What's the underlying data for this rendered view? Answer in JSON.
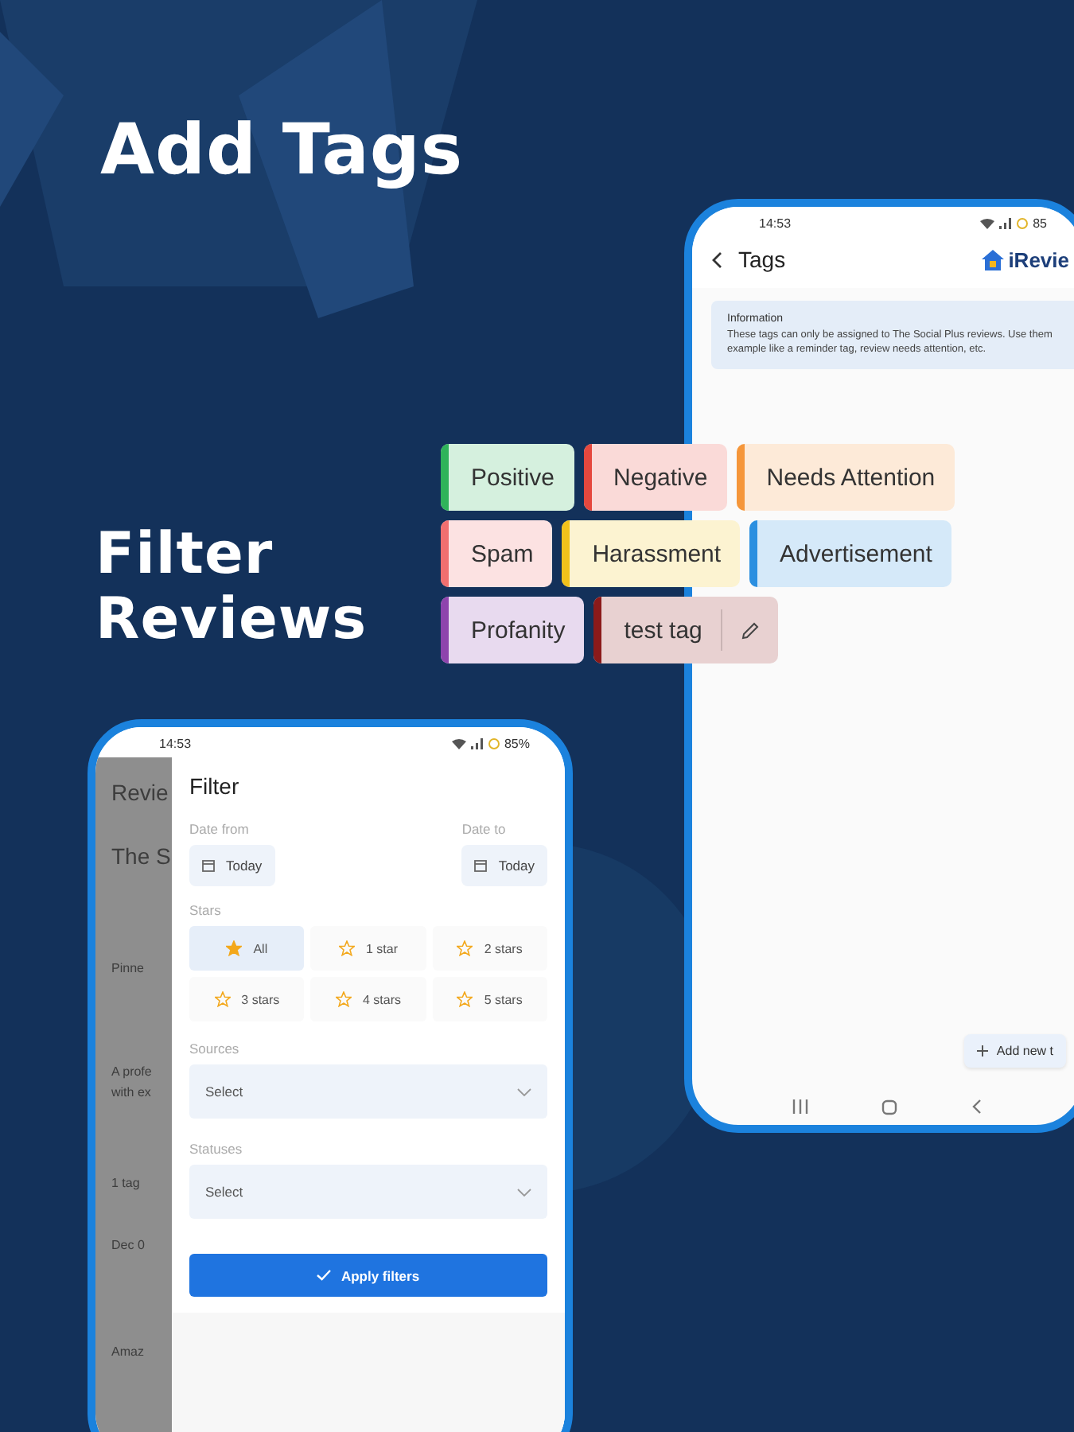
{
  "headlines": [
    {
      "text": "Add Tags"
    },
    {
      "text": "Filter Reviews"
    }
  ],
  "tags_screen": {
    "status": {
      "time": "14:53",
      "battery": "85"
    },
    "title": "Tags",
    "logo": "iRevie",
    "info": {
      "title": "Information",
      "body": "These tags can only be assigned to The Social Plus reviews. Use them example like a reminder tag, review needs attention, etc."
    },
    "add_button": "Add new t",
    "tags": [
      {
        "label": "Positive",
        "color": "#2fb35a",
        "editable": false
      },
      {
        "label": "Negative",
        "color": "#e5483e",
        "editable": false
      },
      {
        "label": "Needs Attention",
        "color": "#f5963a",
        "editable": false
      },
      {
        "label": "Spam",
        "color": "#f06f6f",
        "editable": false
      },
      {
        "label": "Harassment",
        "color": "#f2c21b",
        "editable": false
      },
      {
        "label": "Advertisement",
        "color": "#2b8fe0",
        "editable": false
      },
      {
        "label": "Profanity",
        "color": "#8e44ad",
        "editable": false
      },
      {
        "label": "test tag",
        "color": "#8b1a1a",
        "editable": true
      }
    ]
  },
  "filter_screen": {
    "status": {
      "time": "14:53",
      "battery": "85%"
    },
    "background_list": [
      "Revie",
      "The S",
      "Pinne",
      "A profe",
      "with ex",
      "1 tag",
      "Dec 0",
      "Amaz"
    ],
    "title": "Filter",
    "date_from": {
      "label": "Date from",
      "value": "Today"
    },
    "date_to": {
      "label": "Date to",
      "value": "Today"
    },
    "stars_label": "Stars",
    "star_options": [
      {
        "label": "All",
        "selected": true
      },
      {
        "label": "1 star",
        "selected": false
      },
      {
        "label": "2 stars",
        "selected": false
      },
      {
        "label": "3 stars",
        "selected": false
      },
      {
        "label": "4 stars",
        "selected": false
      },
      {
        "label": "5 stars",
        "selected": false
      }
    ],
    "sources": {
      "label": "Sources",
      "placeholder": "Select"
    },
    "statuses": {
      "label": "Statuses",
      "placeholder": "Select"
    },
    "apply_button": "Apply filters"
  }
}
